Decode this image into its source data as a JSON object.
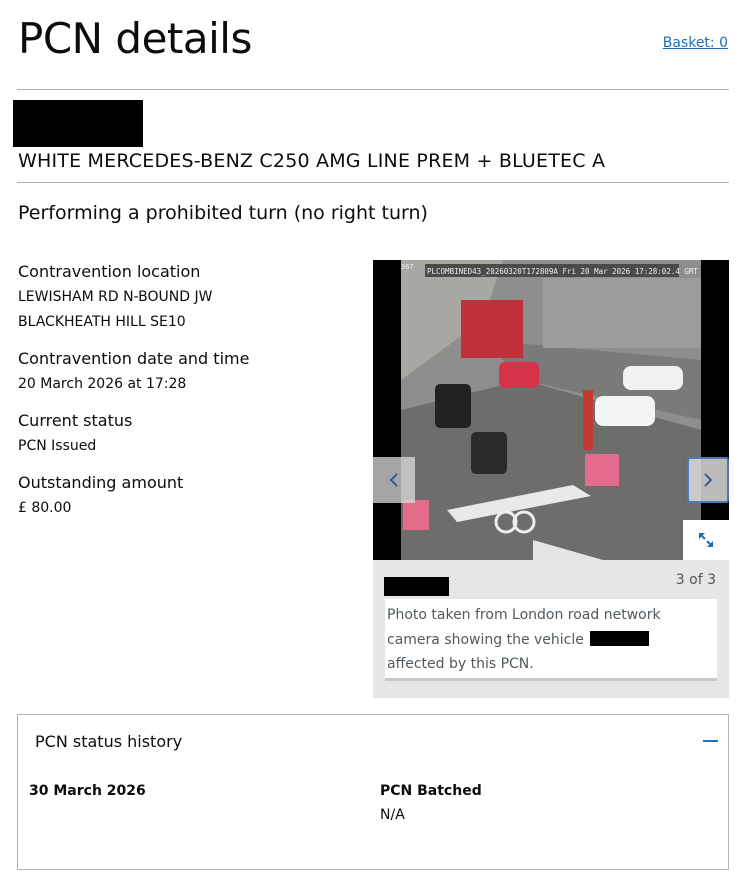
{
  "header": {
    "title": "PCN details",
    "basket_label": "Basket: 0"
  },
  "vehicle": {
    "description": "WHITE MERCEDES-BENZ C250 AMG LINE PREM + BLUETEC A"
  },
  "contravention": {
    "title": "Performing a prohibited turn (no right turn)"
  },
  "details": [
    {
      "label": "Contravention location",
      "lines": [
        "LEWISHAM RD N-BOUND JW",
        "BLACKHEATH HILL SE10"
      ]
    },
    {
      "label": "Contravention date and time",
      "lines": [
        "20 March 2026 at 17:28"
      ]
    },
    {
      "label": "Current status",
      "lines": [
        "PCN Issued"
      ]
    },
    {
      "label": "Outstanding amount",
      "lines": [
        "£ 80.00"
      ]
    }
  ],
  "gallery": {
    "overlay_text": "PLCOMBINED43_20260320T172809A Fri 20 Mar 2026 17:28:02.4 GMT",
    "camera_id": "367",
    "counter": "3 of 3",
    "caption_line1": "Photo taken from London road network",
    "caption_line2_prefix": "camera showing the vehicle",
    "caption_line3": "affected by this PCN.",
    "icons": {
      "prev": "chevron-left-icon",
      "next": "chevron-right-icon",
      "expand": "expand-icon"
    }
  },
  "history": {
    "title": "PCN status history",
    "entries": [
      {
        "date": "30 March 2026",
        "status": "PCN Batched",
        "note": "N/A"
      }
    ]
  },
  "colors": {
    "link": "#1d70b8",
    "text": "#0b0c0c",
    "border": "#b1b4b6",
    "redaction": "#000000"
  }
}
